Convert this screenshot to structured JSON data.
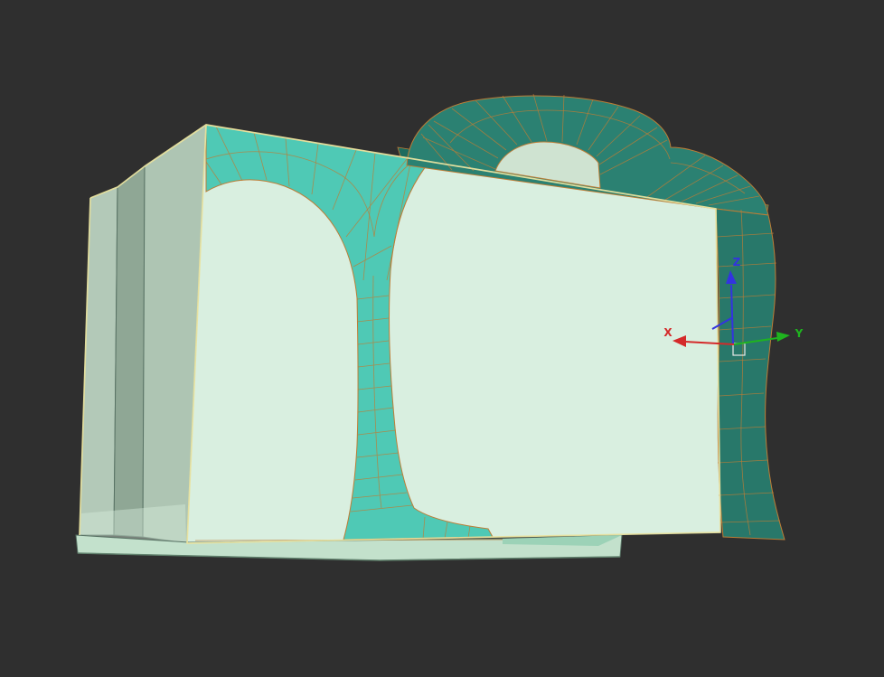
{
  "viewport": {
    "background": "#2f2f2f",
    "tool": "3d-model-viewport"
  },
  "colors": {
    "silhouette": "#e9e3a0",
    "wire": "#bd7d36",
    "face_front": "#d9efe0",
    "face_selected": "#4fc9b5",
    "face_handle": "#2b8172",
    "face_bevel": "#1d6b5e",
    "face_right": "#28786a",
    "face_hole": "#cfe3d1",
    "side_a": "#b3c9b8",
    "side_b": "#8fa795",
    "side_c": "#aec5b3",
    "slab_front": "#c3e1cc",
    "slab_wedge": "#9cd2b7",
    "gizmo_square": "#e8e8e8"
  },
  "gizmo": {
    "axes": [
      {
        "id": "x",
        "label": "X",
        "color": "#d42a2a"
      },
      {
        "id": "y",
        "label": "Y",
        "color": "#1fb41f"
      },
      {
        "id": "z",
        "label": "Z",
        "color": "#3333e0"
      }
    ]
  }
}
